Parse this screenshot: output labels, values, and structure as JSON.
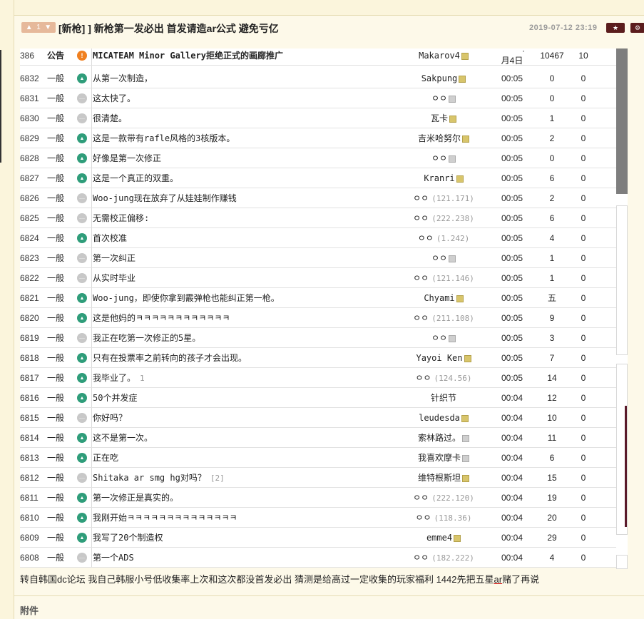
{
  "header": {
    "vote_count": "1",
    "title": "[新枪] ] 新枪第一发必出 首发请造ar公式 避免亏亿",
    "date": "2019-07-12 23:19",
    "star_button": "★",
    "gear_button": "⚙"
  },
  "notice_row": {
    "num": "386",
    "type": "公告",
    "icon": "!",
    "title": "MICATEAM Minor Gallery拒绝正式的画廊推广",
    "writer": "Makarov4",
    "time_top": "·",
    "time": "月4日",
    "views": "10467",
    "recommend": "10"
  },
  "rows": [
    {
      "num": "6832",
      "type": "一般",
      "icon": "image",
      "title": "从第一次制造，",
      "reply": "",
      "writer": "Sakpung",
      "ip": "",
      "nik": "gold",
      "time": "00:05",
      "views": "0",
      "recommend": "0"
    },
    {
      "num": "6831",
      "type": "一般",
      "icon": "text",
      "title": "这太快了。",
      "reply": "",
      "writer": "ㅇㅇ",
      "ip": "",
      "nik": "grey",
      "time": "00:05",
      "views": "0",
      "recommend": "0"
    },
    {
      "num": "6830",
      "type": "一般",
      "icon": "text",
      "title": "很清楚。",
      "reply": "",
      "writer": "瓦卡",
      "ip": "",
      "nik": "gold",
      "time": "00:05",
      "views": "1",
      "recommend": "0"
    },
    {
      "num": "6829",
      "type": "一般",
      "icon": "image",
      "title": "这是一款带有rafle风格的3核版本。",
      "reply": "",
      "writer": "吉米哈努尔",
      "ip": "",
      "nik": "gold",
      "time": "00:05",
      "views": "2",
      "recommend": "0"
    },
    {
      "num": "6828",
      "type": "一般",
      "icon": "image",
      "title": "好像是第一次修正",
      "reply": "",
      "writer": "ㅇㅇ",
      "ip": "",
      "nik": "grey",
      "time": "00:05",
      "views": "0",
      "recommend": "0"
    },
    {
      "num": "6827",
      "type": "一般",
      "icon": "image",
      "title": "这是一个真正的双重。",
      "reply": "",
      "writer": "Kranri",
      "ip": "",
      "nik": "gold",
      "time": "00:05",
      "views": "6",
      "recommend": "0"
    },
    {
      "num": "6826",
      "type": "一般",
      "icon": "text",
      "title": "Woo-jung现在放弃了从娃娃制作赚钱",
      "reply": "",
      "writer": "ㅇㅇ",
      "ip": "(121.171)",
      "nik": "",
      "time": "00:05",
      "views": "2",
      "recommend": "0"
    },
    {
      "num": "6825",
      "type": "一般",
      "icon": "text",
      "title": "无需校正偏移:",
      "reply": "",
      "writer": "ㅇㅇ",
      "ip": "(222.238)",
      "nik": "",
      "time": "00:05",
      "views": "6",
      "recommend": "0"
    },
    {
      "num": "6824",
      "type": "一般",
      "icon": "image",
      "title": "首次校准",
      "reply": "",
      "writer": "ㅇㅇ",
      "ip": "(1.242)",
      "nik": "",
      "time": "00:05",
      "views": "4",
      "recommend": "0"
    },
    {
      "num": "6823",
      "type": "一般",
      "icon": "text",
      "title": "第一次纠正",
      "reply": "",
      "writer": "ㅇㅇ",
      "ip": "",
      "nik": "grey",
      "time": "00:05",
      "views": "1",
      "recommend": "0"
    },
    {
      "num": "6822",
      "type": "一般",
      "icon": "text",
      "title": "从实时毕业",
      "reply": "",
      "writer": "ㅇㅇ",
      "ip": "(121.146)",
      "nik": "",
      "time": "00:05",
      "views": "1",
      "recommend": "0"
    },
    {
      "num": "6821",
      "type": "一般",
      "icon": "image",
      "title": "Woo-jung，即使你拿到霰弹枪也能纠正第一枪。",
      "reply": "",
      "writer": "Chyami",
      "ip": "",
      "nik": "gold",
      "time": "00:05",
      "views": "五",
      "recommend": "0"
    },
    {
      "num": "6820",
      "type": "一般",
      "icon": "image",
      "title": "这是他妈的ㅋㅋㅋㅋㅋㅋㅋㅋㅋㅋㅋㅋ",
      "reply": "",
      "writer": "ㅇㅇ",
      "ip": "(211.108)",
      "nik": "",
      "time": "00:05",
      "views": "9",
      "recommend": "0"
    },
    {
      "num": "6819",
      "type": "一般",
      "icon": "text",
      "title": "我正在吃第一次修正的5星。",
      "reply": "",
      "writer": "ㅇㅇ",
      "ip": "",
      "nik": "grey",
      "time": "00:05",
      "views": "3",
      "recommend": "0"
    },
    {
      "num": "6818",
      "type": "一般",
      "icon": "image",
      "title": "只有在投票率之前转向的孩子才会出现。",
      "reply": "",
      "writer": "Yayoi Ken",
      "ip": "",
      "nik": "gold",
      "time": "00:05",
      "views": "7",
      "recommend": "0"
    },
    {
      "num": "6817",
      "type": "一般",
      "icon": "image",
      "title": "我毕业了。",
      "reply": "1",
      "writer": "ㅇㅇ",
      "ip": "(124.56)",
      "nik": "",
      "time": "00:05",
      "views": "14",
      "recommend": "0"
    },
    {
      "num": "6816",
      "type": "一般",
      "icon": "image",
      "title": "50个并发症",
      "reply": "",
      "writer": "针织节",
      "ip": "",
      "nik": "",
      "time": "00:04",
      "views": "12",
      "recommend": "0"
    },
    {
      "num": "6815",
      "type": "一般",
      "icon": "text",
      "title": "你好吗？",
      "reply": "",
      "writer": "leudesda",
      "ip": "",
      "nik": "gold",
      "time": "00:04",
      "views": "10",
      "recommend": "0"
    },
    {
      "num": "6814",
      "type": "一般",
      "icon": "image",
      "title": "这不是第一次。",
      "reply": "",
      "writer": "索林路过。",
      "ip": "",
      "nik": "grey",
      "time": "00:04",
      "views": "11",
      "recommend": "0"
    },
    {
      "num": "6813",
      "type": "一般",
      "icon": "image",
      "title": "正在吃",
      "reply": "",
      "writer": "我喜欢摩卡",
      "ip": "",
      "nik": "grey",
      "time": "00:04",
      "views": "6",
      "recommend": "0"
    },
    {
      "num": "6812",
      "type": "一般",
      "icon": "text",
      "title": "Shitaka ar smg hg对吗？",
      "reply": "[2]",
      "writer": "维特根斯坦",
      "ip": "",
      "nik": "gold",
      "time": "00:04",
      "views": "15",
      "recommend": "0"
    },
    {
      "num": "6811",
      "type": "一般",
      "icon": "image",
      "title": "第一次修正是真实的。",
      "reply": "",
      "writer": "ㅇㅇ",
      "ip": "(222.120)",
      "nik": "",
      "time": "00:04",
      "views": "19",
      "recommend": "0"
    },
    {
      "num": "6810",
      "type": "一般",
      "icon": "image",
      "title": "我刚开始ㅋㅋㅋㅋㅋㅋㅋㅋㅋㅋㅋㅋㅋㅋ",
      "reply": "",
      "writer": "ㅇㅇ",
      "ip": "(118.36)",
      "nik": "",
      "time": "00:04",
      "views": "20",
      "recommend": "0"
    },
    {
      "num": "6809",
      "type": "一般",
      "icon": "image",
      "title": "我写了20个制造权",
      "reply": "",
      "writer": "emme4",
      "ip": "",
      "nik": "gold",
      "time": "00:04",
      "views": "29",
      "recommend": "0"
    },
    {
      "num": "6808",
      "type": "一般",
      "icon": "text",
      "title": "第一个ADS",
      "reply": "",
      "writer": "ㅇㅇ",
      "ip": "(182.222)",
      "nik": "",
      "time": "00:04",
      "views": "4",
      "recommend": "0"
    }
  ],
  "body": {
    "text_before": "转自韩国dc论坛 我自己韩服小号低收集率上次和这次都没首发必出 猜测是给高过一定收集的玩家福利 1442先把五星",
    "text_underline": "ar",
    "text_after": "赌了再说"
  },
  "attachments_label": "附件",
  "colors": {
    "page_bg": "#fdf9e9",
    "image_icon": "#2f9d7a",
    "notice_icon": "#f08020",
    "header_button": "#5b1d1d"
  }
}
